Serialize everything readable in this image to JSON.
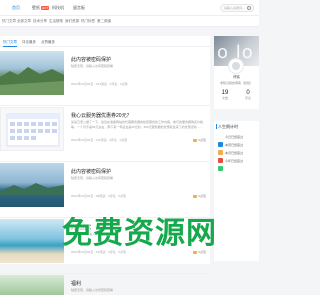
{
  "nav": [
    {
      "label": "首页",
      "active": true
    },
    {
      "label": "壁纸",
      "badge": "HOT"
    },
    {
      "label": "科技机"
    },
    {
      "label": "留言板"
    }
  ],
  "search": {
    "placeholder": "请输入关键词..."
  },
  "subnav": [
    "热门文章",
    "全部文章",
    "技术分享",
    "生活随笔",
    "我们资源",
    "热门标签",
    "第二频道"
  ],
  "tabs": [
    {
      "label": "热门文章",
      "active": true
    },
    {
      "label": "评论最多"
    },
    {
      "label": "点赞最多"
    }
  ],
  "posts": [
    {
      "title": "此内容被密码保护",
      "excerpt": "缺密无意，请输入访问密码查看",
      "meta": "2022年04月02日 · 151阅读 · 0评论 · 0点赞",
      "likes": ""
    },
    {
      "title": "我心云服务器优惠券20元？",
      "excerpt": "某某云老公做了一下，最近在准备网站的代理服务器的续费服务的工作内容，他们的服务器购买价格等，一个月不是50元左右，那下来一年后台是30元的，500元服务器的优惠就会来了的优惠活动……",
      "meta": "2022年04月02日 · 111阅读 · 0评论 · 0点赞",
      "likes": "0点赞"
    },
    {
      "title": "此内容被密码保护",
      "excerpt": "缺密无意，请输入访问密码查看",
      "meta": "2022年04月02日 · 98阅读 · 0评论 · 0点赞",
      "likes": "0点赞"
    },
    {
      "title": "购买测试",
      "excerpt": "缺密无意，请输入访问密码查看",
      "meta": "2022年04月02日 · 67阅读 · 0评论 · 0点赞",
      "likes": "0点赞"
    },
    {
      "title": "福利",
      "excerpt": "缺密无意，请输入访问密码查看",
      "meta": "2022年04月02日 · 45阅读 · 0评论 · 0点赞",
      "likes": ""
    }
  ],
  "profile": {
    "cover_text": "o lo",
    "username": "博客",
    "bio": "非知识我的博客（纪检）",
    "stats": [
      {
        "num": "19",
        "label": "文章"
      },
      {
        "num": "0",
        "label": "评论"
      }
    ]
  },
  "widget": {
    "title": "人生倒计时",
    "rows": [
      "今日已经度过",
      "本周已经度过",
      "本月已经度过",
      "今年已经度过"
    ],
    "colors": [
      "#1e88e5",
      "#f0ad4e",
      "#e74c3c",
      "#2ecc71"
    ]
  },
  "overlay_text": "免费资源网"
}
